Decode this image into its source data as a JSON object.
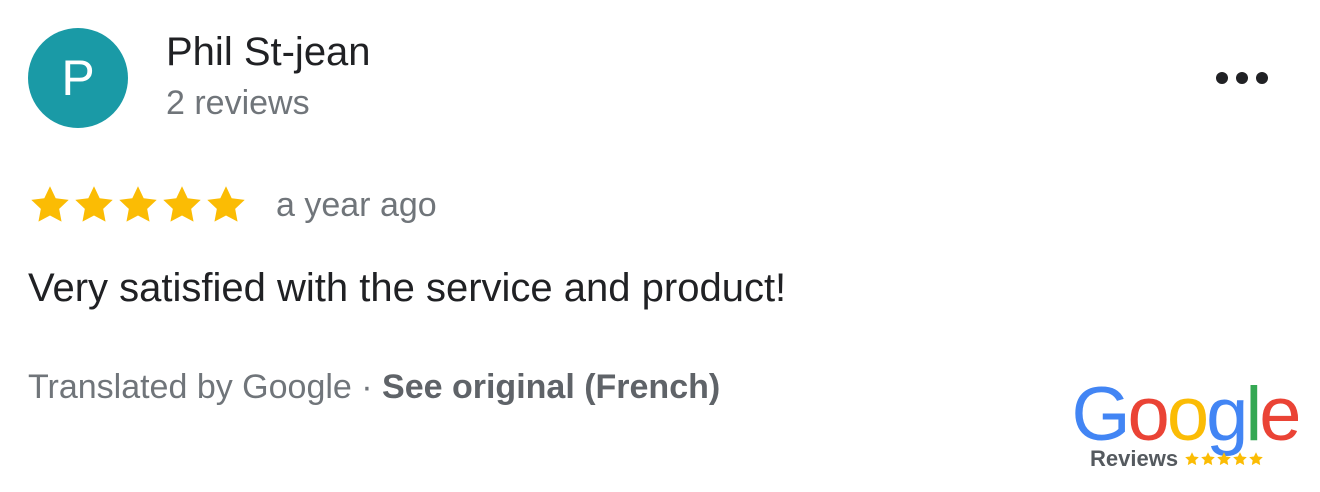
{
  "reviewer": {
    "initial": "P",
    "name": "Phil St-jean",
    "review_count": "2 reviews",
    "avatar_color": "#1a9aa6"
  },
  "menu": {
    "icon": "more-horizontal-icon"
  },
  "review": {
    "rating": 5,
    "rating_max": 5,
    "star_color": "#fbbc04",
    "date": "a year ago",
    "text": "Very satisfied with the service and product!"
  },
  "translation": {
    "prefix": "Translated by Google · ",
    "link": "See original (French)"
  },
  "badge": {
    "logo_text": "Google",
    "label": "Reviews",
    "rating": 5,
    "logo_colors": [
      "#4285f4",
      "#ea4335",
      "#fbbc05",
      "#4285f4",
      "#34a853",
      "#ea4335"
    ]
  }
}
